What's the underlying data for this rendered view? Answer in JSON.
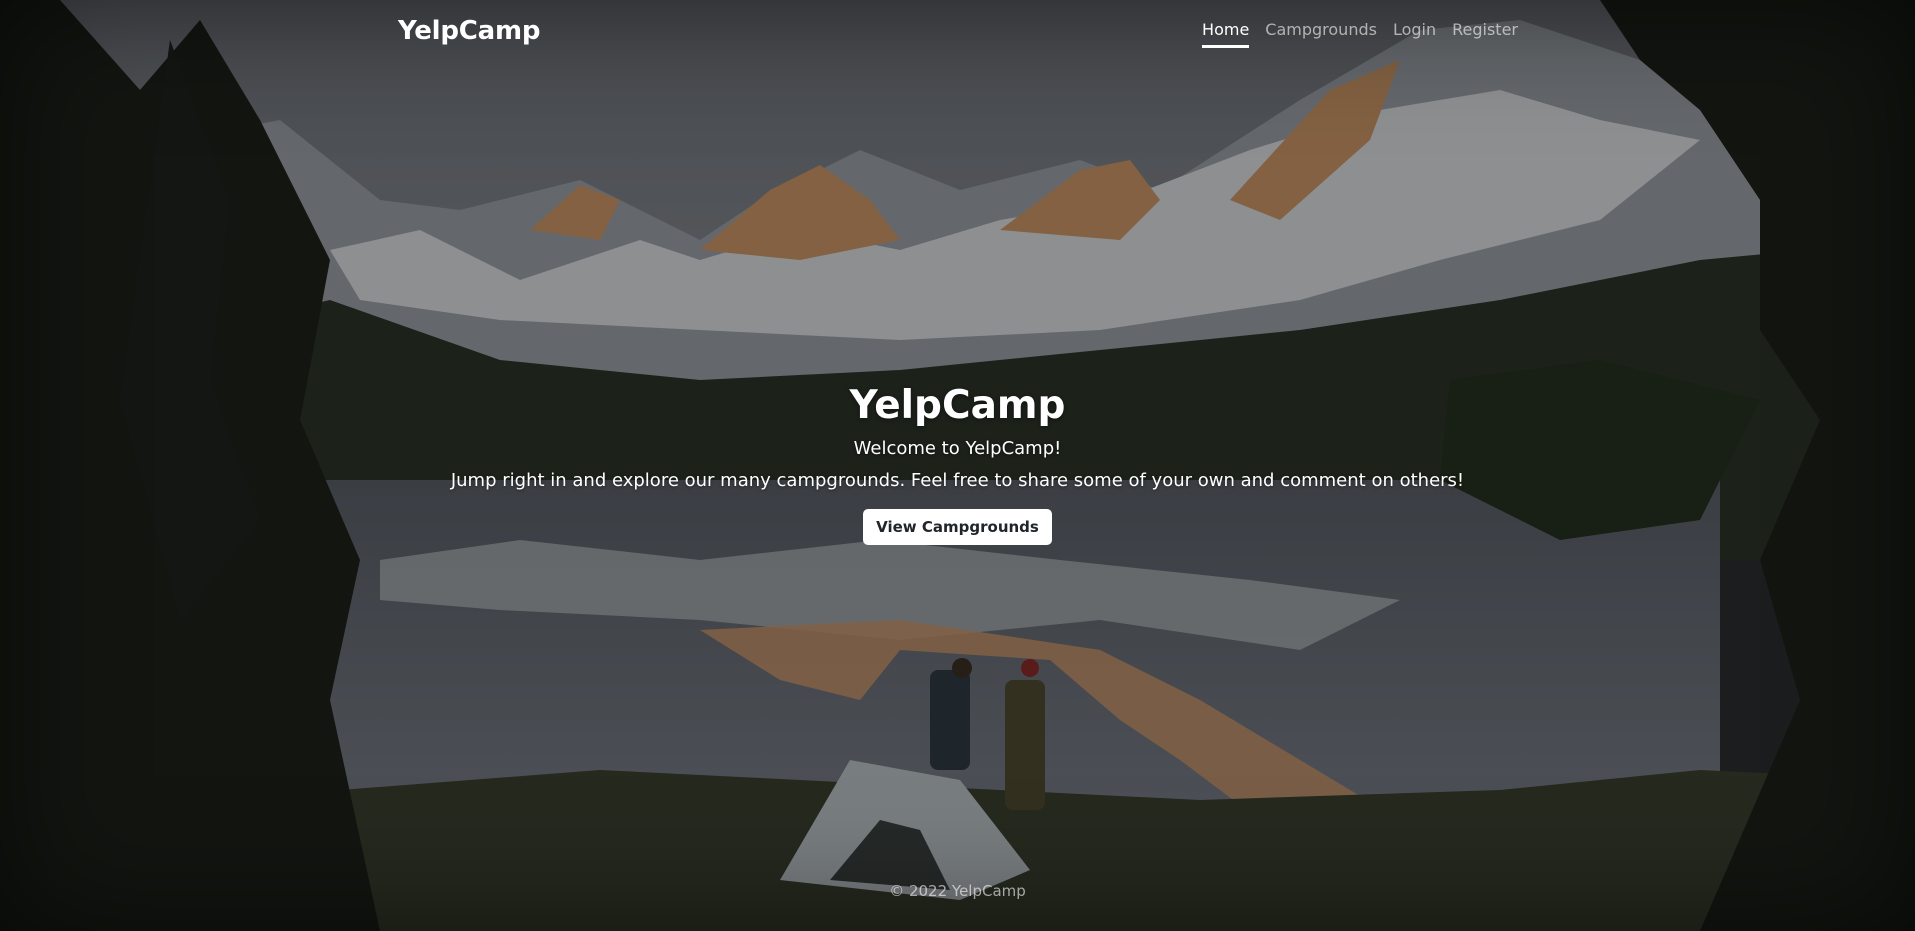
{
  "nav": {
    "brand": "YelpCamp",
    "links": [
      {
        "label": "Home",
        "active": true
      },
      {
        "label": "Campgrounds",
        "active": false
      },
      {
        "label": "Login",
        "active": false
      },
      {
        "label": "Register",
        "active": false
      }
    ]
  },
  "hero": {
    "title": "YelpCamp",
    "lead_line1": "Welcome to YelpCamp!",
    "lead_line2": "Jump right in and explore our many campgrounds. Feel free to share some of your own and comment on others!",
    "button_label": "View Campgrounds"
  },
  "footer": {
    "text": "© 2022 YelpCamp"
  }
}
